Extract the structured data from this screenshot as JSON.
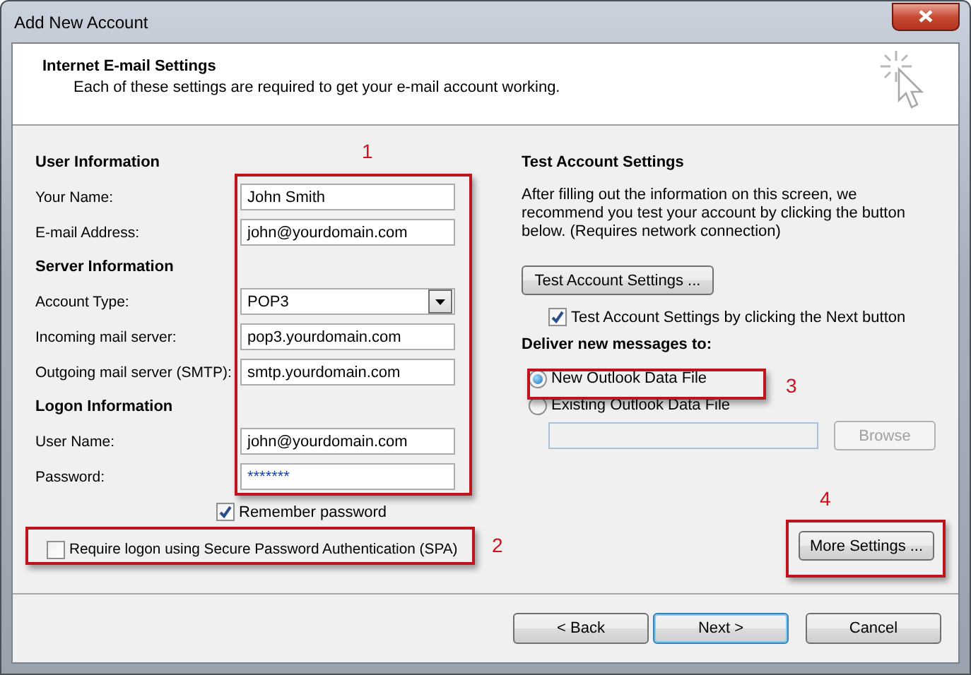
{
  "window": {
    "title": "Add New Account"
  },
  "header": {
    "title": "Internet E-mail Settings",
    "subtitle": "Each of these settings are required to get your e-mail account working."
  },
  "sections": [
    {
      "heading": "User Information",
      "fields": [
        {
          "label": "Your Name:",
          "value": "John Smith",
          "kind": "text"
        },
        {
          "label": "E-mail Address:",
          "value": "john@yourdomain.com",
          "kind": "text"
        }
      ]
    },
    {
      "heading": "Server Information",
      "fields": [
        {
          "label": "Account Type:",
          "value": "POP3",
          "kind": "dropdown"
        },
        {
          "label": "Incoming mail server:",
          "value": "pop3.yourdomain.com",
          "kind": "text"
        },
        {
          "label": "Outgoing mail server (SMTP):",
          "value": "smtp.yourdomain.com",
          "kind": "text"
        }
      ]
    },
    {
      "heading": "Logon Information",
      "fields": [
        {
          "label": "User Name:",
          "value": "john@yourdomain.com",
          "kind": "text"
        },
        {
          "label": "Password:",
          "value": "*******",
          "kind": "password"
        }
      ]
    }
  ],
  "remember_password": {
    "label": "Remember password",
    "checked": true
  },
  "spa": {
    "label": "Require logon using Secure Password Authentication (SPA)",
    "checked": false
  },
  "test_settings": {
    "heading": "Test Account Settings",
    "description": "After filling out the information on this screen, we recommend you test your account by clicking the button below. (Requires network connection)",
    "button": "Test Account Settings ...",
    "checkbox": {
      "label": "Test Account Settings by clicking the Next button",
      "checked": true
    }
  },
  "deliver": {
    "heading": "Deliver new messages to:",
    "options": [
      {
        "label": "New Outlook Data File",
        "selected": true
      },
      {
        "label": "Existing Outlook Data File",
        "selected": false
      }
    ],
    "browse": {
      "label": "Browse",
      "disabled": true
    }
  },
  "more_settings": "More Settings ...",
  "footer_buttons": [
    {
      "label": "< Back",
      "default": false
    },
    {
      "label": "Next >",
      "default": true
    },
    {
      "label": "Cancel",
      "default": false
    }
  ],
  "annotations": [
    {
      "label": "1"
    },
    {
      "label": "2"
    },
    {
      "label": "3"
    },
    {
      "label": "4"
    }
  ]
}
